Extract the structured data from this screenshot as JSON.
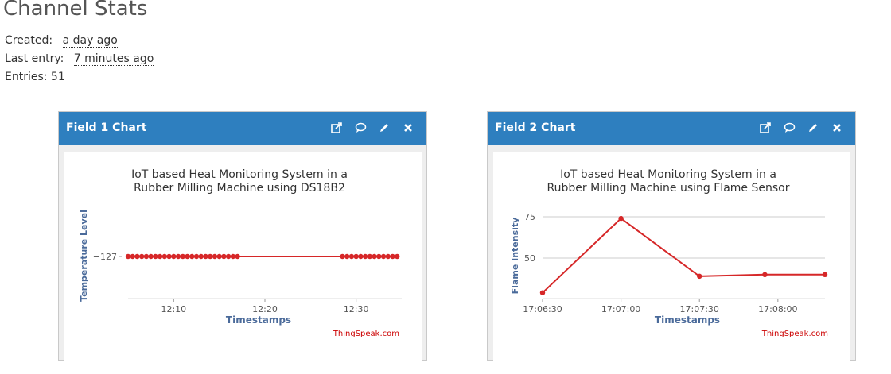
{
  "page": {
    "title": "Channel Stats",
    "created_label": "Created:",
    "created_value": "a day ago",
    "last_entry_label": "Last entry:",
    "last_entry_value": "7 minutes ago",
    "entries_text": "Entries: 51"
  },
  "panels": [
    {
      "title": "Field 1 Chart",
      "icons": [
        "external-link-icon",
        "comment-icon",
        "pencil-icon",
        "close-icon"
      ]
    },
    {
      "title": "Field 2 Chart",
      "icons": [
        "external-link-icon",
        "comment-icon",
        "pencil-icon",
        "close-icon"
      ]
    }
  ],
  "colors": {
    "header": "#2e7fbf",
    "line": "#d62728",
    "credit": "#cc0000",
    "axis_label": "#4a6a9a"
  },
  "chart_data": [
    {
      "type": "line",
      "title": "IoT based Heat Monitoring System in a Rubber Milling Machine using DS18B2",
      "title_lines": [
        "IoT based Heat Monitoring System in a",
        "Rubber Milling Machine using DS18B2"
      ],
      "xlabel": "Timestamps",
      "ylabel": "Temperature Level",
      "credit": "ThingSpeak.com",
      "x_tick_labels": [
        "12:10",
        "12:20",
        "12:30"
      ],
      "y_tick_labels": [
        "-127"
      ],
      "xlim_minutes": [
        "12:05",
        "12:35"
      ],
      "series": [
        {
          "x": [
            "12:05:00",
            "12:05:30",
            "12:06:00",
            "12:06:30",
            "12:07:00",
            "12:07:30",
            "12:08:00",
            "12:08:30",
            "12:09:00",
            "12:09:30",
            "12:10:00",
            "12:10:30",
            "12:11:00",
            "12:11:30",
            "12:12:00",
            "12:12:30",
            "12:13:00",
            "12:13:30",
            "12:14:00",
            "12:14:30",
            "12:15:00",
            "12:15:30",
            "12:16:00",
            "12:16:30",
            "12:17:00",
            "12:28:30",
            "12:29:00",
            "12:29:30",
            "12:30:00",
            "12:30:30",
            "12:31:00",
            "12:31:30",
            "12:32:00",
            "12:32:30",
            "12:33:00",
            "12:33:30",
            "12:34:00",
            "12:34:30"
          ],
          "y": [
            -127,
            -127,
            -127,
            -127,
            -127,
            -127,
            -127,
            -127,
            -127,
            -127,
            -127,
            -127,
            -127,
            -127,
            -127,
            -127,
            -127,
            -127,
            -127,
            -127,
            -127,
            -127,
            -127,
            -127,
            -127,
            -127,
            -127,
            -127,
            -127,
            -127,
            -127,
            -127,
            -127,
            -127,
            -127,
            -127,
            -127,
            -127
          ]
        }
      ]
    },
    {
      "type": "line",
      "title": "IoT based Heat Monitoring System in a Rubber Milling Machine using Flame Sensor",
      "title_lines": [
        "IoT based Heat Monitoring System in a",
        "Rubber Milling Machine using Flame Sensor"
      ],
      "xlabel": "Timestamps",
      "ylabel": "Flame Intensity",
      "credit": "ThingSpeak.com",
      "x_tick_labels": [
        "17:06:30",
        "17:07:00",
        "17:07:30",
        "17:08:00"
      ],
      "y_tick_labels": [
        "50",
        "75"
      ],
      "ylim": [
        28,
        75
      ],
      "xlim": [
        "17:06:30",
        "17:08:18"
      ],
      "series": [
        {
          "x": [
            "17:06:30",
            "17:07:00",
            "17:07:30",
            "17:07:55",
            "17:08:18"
          ],
          "y": [
            29,
            74,
            39,
            40,
            40
          ]
        }
      ]
    }
  ]
}
